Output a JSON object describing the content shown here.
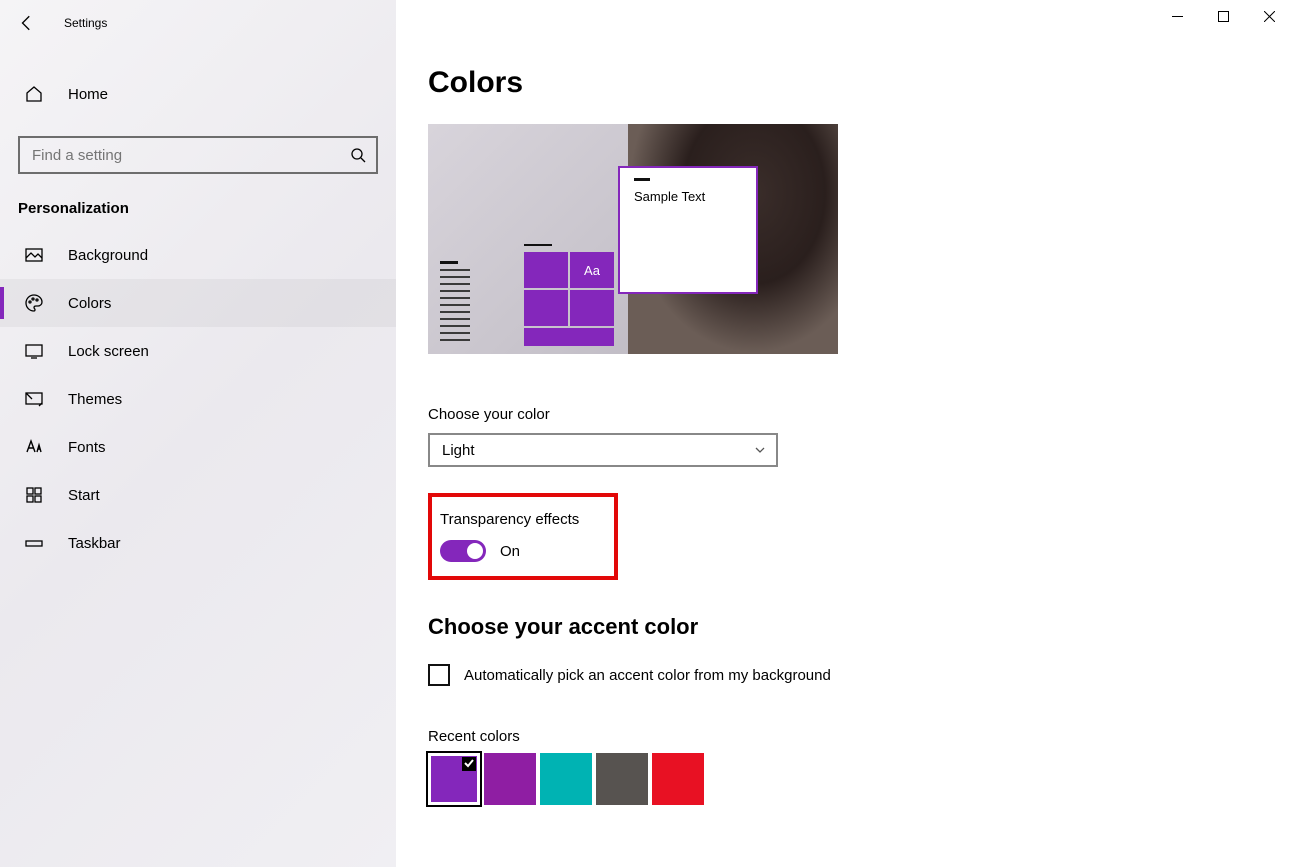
{
  "app_title": "Settings",
  "window": {
    "minimize": "−",
    "maximize": "□",
    "close": "✕"
  },
  "home_label": "Home",
  "search": {
    "placeholder": "Find a setting"
  },
  "section_title": "Personalization",
  "nav": [
    {
      "key": "background",
      "label": "Background"
    },
    {
      "key": "colors",
      "label": "Colors",
      "active": true
    },
    {
      "key": "lockscreen",
      "label": "Lock screen"
    },
    {
      "key": "themes",
      "label": "Themes"
    },
    {
      "key": "fonts",
      "label": "Fonts"
    },
    {
      "key": "start",
      "label": "Start"
    },
    {
      "key": "taskbar",
      "label": "Taskbar"
    }
  ],
  "page_title": "Colors",
  "preview": {
    "sample_text": "Sample Text",
    "aa": "Aa"
  },
  "choose_color": {
    "label": "Choose your color",
    "value": "Light"
  },
  "transparency": {
    "label": "Transparency effects",
    "state_text": "On",
    "enabled": true
  },
  "accent": {
    "heading": "Choose your accent color",
    "auto_label": "Automatically pick an accent color from my background",
    "auto_checked": false,
    "recent_label": "Recent colors",
    "recent_colors": [
      "#8427bb",
      "#8f1ea3",
      "#00b3b3",
      "#575350",
      "#e81123"
    ],
    "selected_index": 0
  },
  "accent_color": "#8427bb"
}
